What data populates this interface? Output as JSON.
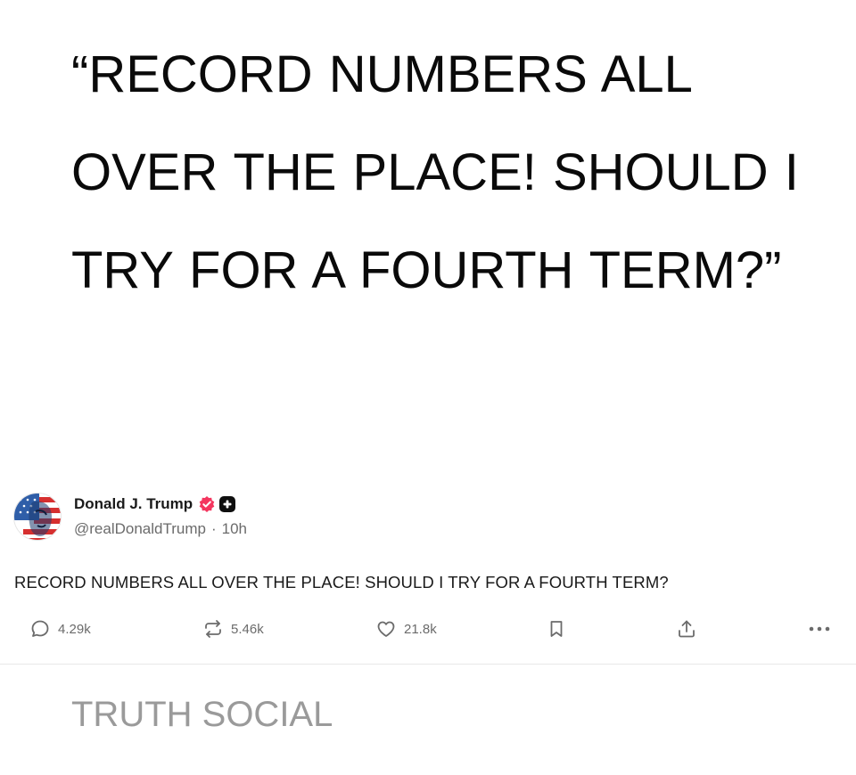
{
  "quote": {
    "text": "“RECORD NUMBERS ALL OVER THE PLACE! SHOULD I TRY FOR A FOURTH TERM?”"
  },
  "post": {
    "author_name": "Donald J. Trump",
    "handle": "@realDonaldTrump",
    "separator": "·",
    "time": "10h",
    "text": "RECORD NUMBERS ALL OVER THE PLACE! SHOULD I TRY FOR A FOURTH TERM?",
    "verified_badge_color": "#f4365f"
  },
  "actions": {
    "replies": "4.29k",
    "retruths": "5.46k",
    "likes": "21.8k"
  },
  "brand": {
    "label": "TRUTH SOCIAL"
  },
  "icons": [
    "reply-icon",
    "retruth-icon",
    "like-icon",
    "bookmark-icon",
    "share-icon",
    "more-icon",
    "verified-icon",
    "plus-badge-icon"
  ]
}
